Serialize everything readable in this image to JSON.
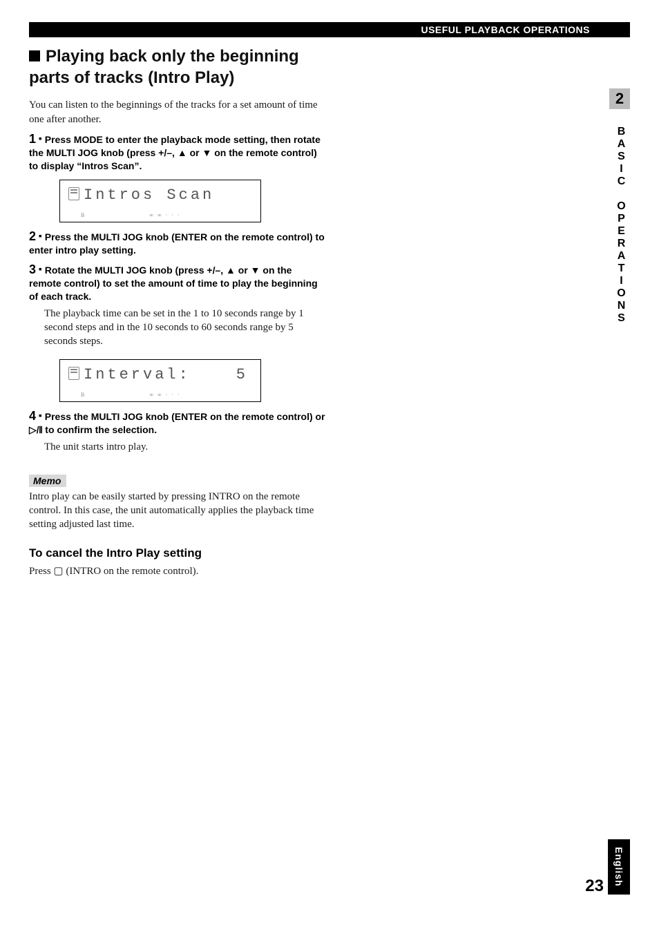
{
  "header": {
    "section_title": "USEFUL PLAYBACK OPERATIONS"
  },
  "title": "Playing back only the beginning parts of tracks (Intro Play)",
  "intro": "You can listen to the beginnings of the tracks for a set amount of time one after another.",
  "steps": [
    {
      "num": "1",
      "bold": "Press MODE to enter the playback mode setting, then rotate the MULTI JOG knob (press +/–, ▲ or ▼ on the remote control) to display “Intros Scan”.",
      "lcd_main": "Intros Scan",
      "lcd_sub": "B",
      "lcd_marks": "∞ ∞  ·  · ·"
    },
    {
      "num": "2",
      "bold": "Press the MULTI JOG knob (ENTER on the remote control) to enter intro play setting."
    },
    {
      "num": "3",
      "bold": "Rotate the MULTI JOG knob (press +/–, ▲ or ▼ on the remote control) to set the amount of time to play the beginning of each track.",
      "body": "The playback time can be set in the 1 to 10 seconds range by 1 second steps and in the 10 seconds to 60 seconds range by 5 seconds steps.",
      "lcd_main": "Interval:",
      "lcd_val": "5",
      "lcd_sub": "B",
      "lcd_marks": "∞ ∞  ·  · ·"
    },
    {
      "num": "4",
      "bold": "Press the MULTI JOG knob (ENTER on the remote control) or ▷/𝍪 to confirm the selection.",
      "body": "The unit starts intro play."
    }
  ],
  "memo": {
    "label": "Memo",
    "text": "Intro play can be easily started by pressing INTRO on the remote control. In this case, the unit automatically applies the playback time setting adjusted last time."
  },
  "cancel": {
    "heading": "To cancel the Intro Play setting",
    "text_prefix": "Press ",
    "text_suffix": " (INTRO on the remote control)."
  },
  "side": {
    "chapter": "2",
    "label": "BASIC OPERATIONS",
    "language": "English",
    "page": "23"
  }
}
